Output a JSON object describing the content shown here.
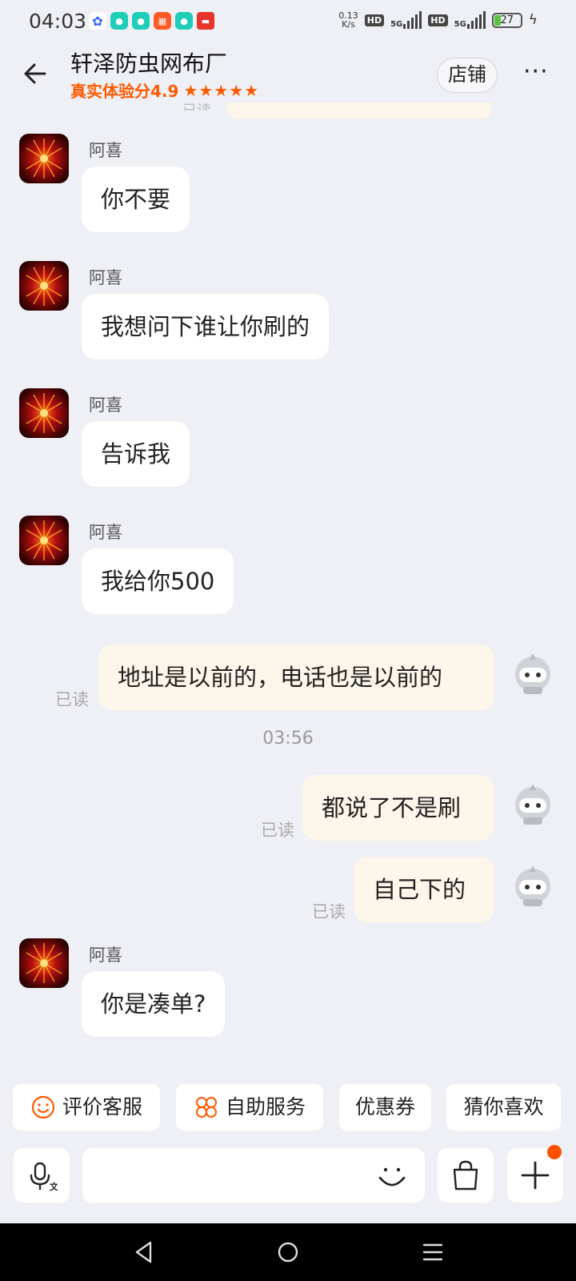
{
  "status_bar": {
    "time": "04:03",
    "net_speed_value": "0.13",
    "net_speed_unit": "K/s",
    "hd1": "HD",
    "sig1_label": "5G",
    "hd2": "HD",
    "sig2_label": "5G",
    "battery": "27",
    "battery_level_percent": 27
  },
  "header": {
    "shop_name": "轩泽防虫网布厂",
    "score_label": "真实体验分4.9",
    "stars": "★★★★★",
    "store_button": "店铺",
    "more": "···"
  },
  "ghost": {
    "read_label": "已读"
  },
  "messages": {
    "m1": {
      "sender": "阿喜",
      "text": "你不要"
    },
    "m2": {
      "sender": "阿喜",
      "text": "我想问下谁让你刷的"
    },
    "m3": {
      "sender": "阿喜",
      "text": "告诉我"
    },
    "m4": {
      "sender": "阿喜",
      "text": "我给你500"
    },
    "m5": {
      "text": "地址是以前的，电话也是以前的",
      "read": "已读"
    },
    "timestamp": "03:56",
    "m6": {
      "text": "都说了不是刷",
      "read": "已读"
    },
    "m7": {
      "text": "自己下的",
      "read": "已读"
    },
    "m8": {
      "sender": "阿喜",
      "text": "你是凑单?"
    }
  },
  "quick_actions": {
    "rate_service": "评价客服",
    "self_service": "自助服务",
    "coupons": "优惠券",
    "guess_you_like": "猜你喜欢"
  },
  "colors": {
    "accent": "#ff5a00",
    "chat_bg": "#eef0f5",
    "outgoing_bubble": "#fdf6ea",
    "incoming_bubble": "#ffffff"
  }
}
